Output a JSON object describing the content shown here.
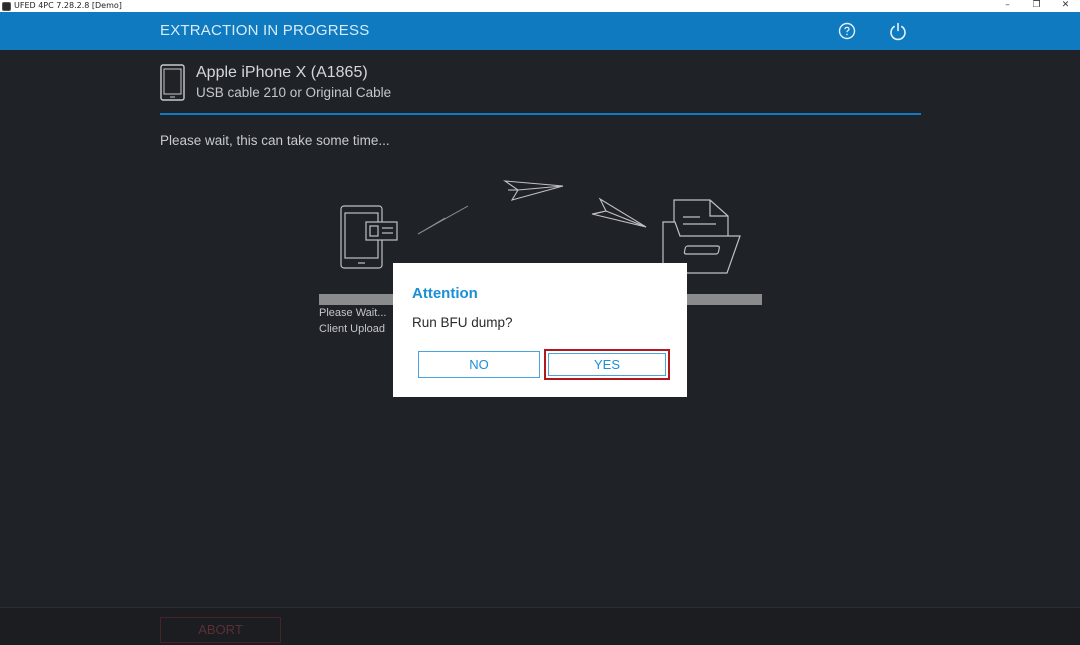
{
  "window": {
    "title": "UFED 4PC 7.28.2.8 [Demo]",
    "controls": {
      "minimize": "–",
      "restore": "❐",
      "close": "✕"
    }
  },
  "header": {
    "title": "EXTRACTION IN PROGRESS",
    "help_icon": "help-circle-icon",
    "power_icon": "power-icon",
    "color": "#0f7ac0"
  },
  "device": {
    "name": "Apple iPhone X (A1865)",
    "cable": "USB cable 210 or Original Cable",
    "icon": "phone-icon"
  },
  "main": {
    "wait_message": "Please wait, this can take some time...",
    "status_line1": "Please Wait...",
    "status_line2": "Client Upload"
  },
  "dialog": {
    "title": "Attention",
    "message": "Run BFU dump?",
    "no_label": "NO",
    "yes_label": "YES"
  },
  "footer": {
    "abort_label": "ABORT"
  },
  "colors": {
    "accent": "#1a8fd6",
    "background": "#1f2227",
    "highlight_border": "#b2191d"
  }
}
